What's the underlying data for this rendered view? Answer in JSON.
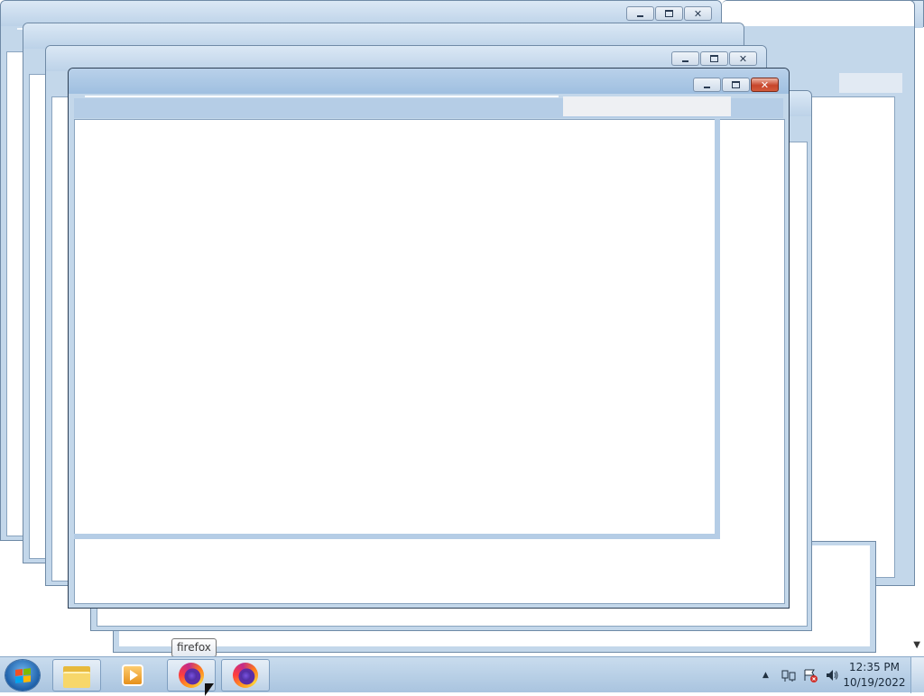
{
  "windows": [
    {
      "id": "window-1",
      "minimize": "minimize",
      "maximize": "maximize",
      "close": "close"
    },
    {
      "id": "window-2",
      "minimize": "minimize",
      "maximize": "maximize",
      "close": "close"
    },
    {
      "id": "window-3",
      "minimize": "minimize",
      "maximize": "maximize",
      "close": "close"
    },
    {
      "id": "window-4",
      "minimize": "minimize",
      "maximize": "maximize",
      "close": "close"
    },
    {
      "id": "window-5-active",
      "minimize": "minimize",
      "maximize": "maximize",
      "close": "close"
    }
  ],
  "taskbar": {
    "start_icon": "windows-logo-icon",
    "pinned": [
      {
        "icon": "folder-icon",
        "label": "Windows Explorer"
      },
      {
        "icon": "media-player-icon",
        "label": "Windows Media Player"
      },
      {
        "icon": "firefox-icon",
        "label": "firefox"
      },
      {
        "icon": "firefox-icon",
        "label": "firefox"
      }
    ],
    "tooltip": "firefox",
    "tray": {
      "icons": [
        "show-hidden-icons-arrow",
        "network-icon",
        "action-center-icon",
        "volume-icon"
      ],
      "time": "12:35 PM",
      "date": "10/19/2022"
    }
  }
}
